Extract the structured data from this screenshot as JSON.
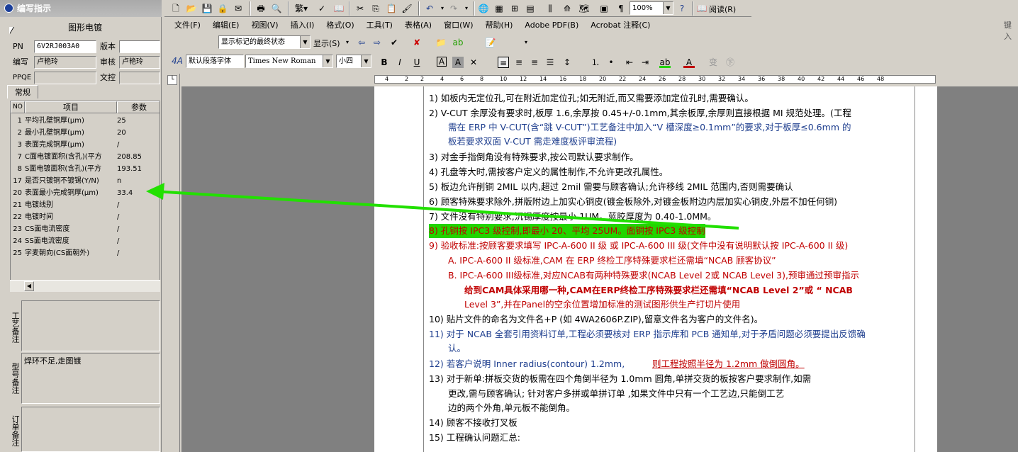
{
  "panel": {
    "title": "编写指示",
    "type": "图形电镀",
    "fields": [
      {
        "label": "PN",
        "value": "6V2RJ003A0"
      },
      {
        "label": "版本",
        "value": ""
      },
      {
        "label": "编写",
        "value": "卢艳玲"
      },
      {
        "label": "审核",
        "value": "卢艳玲"
      },
      {
        "label": "PPQE",
        "value": ""
      },
      {
        "label": "文控",
        "value": ""
      }
    ],
    "tab": "常规",
    "grid_headers": {
      "no": "NO",
      "name": "项目",
      "value": "参数"
    },
    "rows": [
      {
        "no": "1",
        "name": "平均孔壁铜厚(μm)",
        "value": "25"
      },
      {
        "no": "2",
        "name": "最小孔壁铜厚(μm)",
        "value": "20"
      },
      {
        "no": "3",
        "name": "表面完成铜厚(μm)",
        "value": "/"
      },
      {
        "no": "7",
        "name": "C面电镀面积(含孔)(平方",
        "value": "208.85"
      },
      {
        "no": "8",
        "name": "S面电镀面积(含孔)(平方",
        "value": "193.51"
      },
      {
        "no": "17",
        "name": "是否只镀铜不镀锡(Y/N)",
        "value": "n"
      },
      {
        "no": "20",
        "name": "表面最小完成铜厚(μm)",
        "value": "33.4"
      },
      {
        "no": "21",
        "name": "电镀线别",
        "value": "/"
      },
      {
        "no": "22",
        "name": "电镀时间",
        "value": "/"
      },
      {
        "no": "23",
        "name": "CS面电流密度",
        "value": "/"
      },
      {
        "no": "24",
        "name": "SS面电流密度",
        "value": "/"
      },
      {
        "no": "25",
        "name": "字麦朝向(CS面朝外)",
        "value": "/"
      }
    ],
    "memos": [
      {
        "label": "工艺备注",
        "text": ""
      },
      {
        "label": "型号备注",
        "text": "焊环不足,走图镀"
      },
      {
        "label": "订单备注",
        "text": ""
      }
    ]
  },
  "word": {
    "zoom": "100%",
    "read": "阅读(R)",
    "menu": [
      "文件(F)",
      "编辑(E)",
      "视图(V)",
      "插入(I)",
      "格式(O)",
      "工具(T)",
      "表格(A)",
      "窗口(W)",
      "帮助(H)",
      "Adobe PDF(B)",
      "Acrobat 注释(C)"
    ],
    "help_box": "键入",
    "markup": "显示标记的最终状态",
    "show": "显示(S)",
    "style": "默认段落字体",
    "font": "Times New Roman",
    "size": "小四",
    "ruler": [
      "4",
      "2",
      "2",
      "4",
      "6",
      "8",
      "10",
      "12",
      "14",
      "16",
      "18",
      "20",
      "22",
      "24",
      "26",
      "28",
      "30",
      "32",
      "34",
      "36",
      "38",
      "40",
      "42",
      "44",
      "46",
      "48"
    ]
  },
  "doc": {
    "lines": [
      {
        "t": "1)  如板内无定位孔,可在附近加定位孔;如无附近,而又需要添加定位孔时,需要确认。"
      },
      {
        "t": "2)  V-CUT 余厚没有要求时,板厚 1.6,余厚按 0.45+/-0.1mm,其余板厚,余厚则直接根据 MI 规范处理。(工程"
      },
      {
        "t": "需在 ERP 中 V-CUT(含“跳 V-CUT”)工艺备注中加入“V 槽深度≥0.1mm”的要求,对于板厚≤0.6mm 的"
      },
      {
        "t": "板若要求双面 V-CUT 需走难度板评审流程)"
      },
      {
        "t": "3)  对金手指倒角没有特殊要求,按公司默认要求制作。"
      },
      {
        "t": "4)  孔盘等大时,需按客户定义的属性制作,不允许更改孔属性。"
      },
      {
        "t": "5)  板边允许削铜 2MIL 以内,超过 2mil 需要与顾客确认;允许移线 2MIL 范围内,否则需要确认"
      },
      {
        "t": "6)  顾客特殊要求除外,拼版附边上加实心铜皮(镀金板除外,对镀金板附边内层加实心铜皮,外层不加任何铜)"
      },
      {
        "t": "7)  文件没有特别要求,沉锡厚度按最小 1UM。蓝胶厚度为 0.40-1.0MM。"
      },
      {
        "t": "8)  孔铜按 IPC3 级控制,即最小 20、平均 25UM。面铜按 IPC3 级控制"
      },
      {
        "t": "9)  验收标准:按顾客要求填写 IPC-A-600 II 级 或 IPC-A-600 III 级(文件中没有说明默认按 IPC-A-600 II 级)"
      },
      {
        "t": "A.  IPC-A-600 II 级标准,CAM 在 ERP 终检工序特殊要求栏还需填“NCAB 顾客协议”"
      },
      {
        "t": "B.  IPC-A-600 III级标准,对应NCAB有两种特殊要求(NCAB Level 2或 NCAB Level 3),预审通过预审指示"
      },
      {
        "t": "给到CAM具体采用哪一种,CAM在ERP终检工序特殊要求栏还需填“NCAB Level 2”或 “ NCAB"
      },
      {
        "t": "Level 3”,并在Panel的空余位置增加标准的测试图形供生产打切片使用"
      },
      {
        "t": "10) 贴片文件的命名为文件名+P  (如 4WA2606P.ZIP),留意文件名为客户的文件名)。"
      },
      {
        "t": "11) 对于 NCAB 全套引用资料订单,工程必须要核对 ERP 指示库和 PCB 通知单,对于矛盾问题必须要提出反馈确"
      },
      {
        "t": "认。"
      },
      {
        "t": "12) 若客户说明 Inner radius(contour) 1.2mm,"
      },
      {
        "t": "则工程按照半径为 1.2mm 做倒圆角。"
      },
      {
        "t": "13) 对于新单:拼板交货的板需在四个角倒半径为 1.0mm 圆角,单拼交货的板按客户要求制作,如需"
      },
      {
        "t": "更改,需与顾客确认;  针对客户多拼或单拼订单 ,如果文件中只有一个工艺边,只能倒工艺"
      },
      {
        "t": "边的两个外角,单元板不能倒角。"
      },
      {
        "t": "14) 顾客不接收打叉板"
      },
      {
        "t": "15) 工程确认问题汇总:"
      }
    ]
  }
}
